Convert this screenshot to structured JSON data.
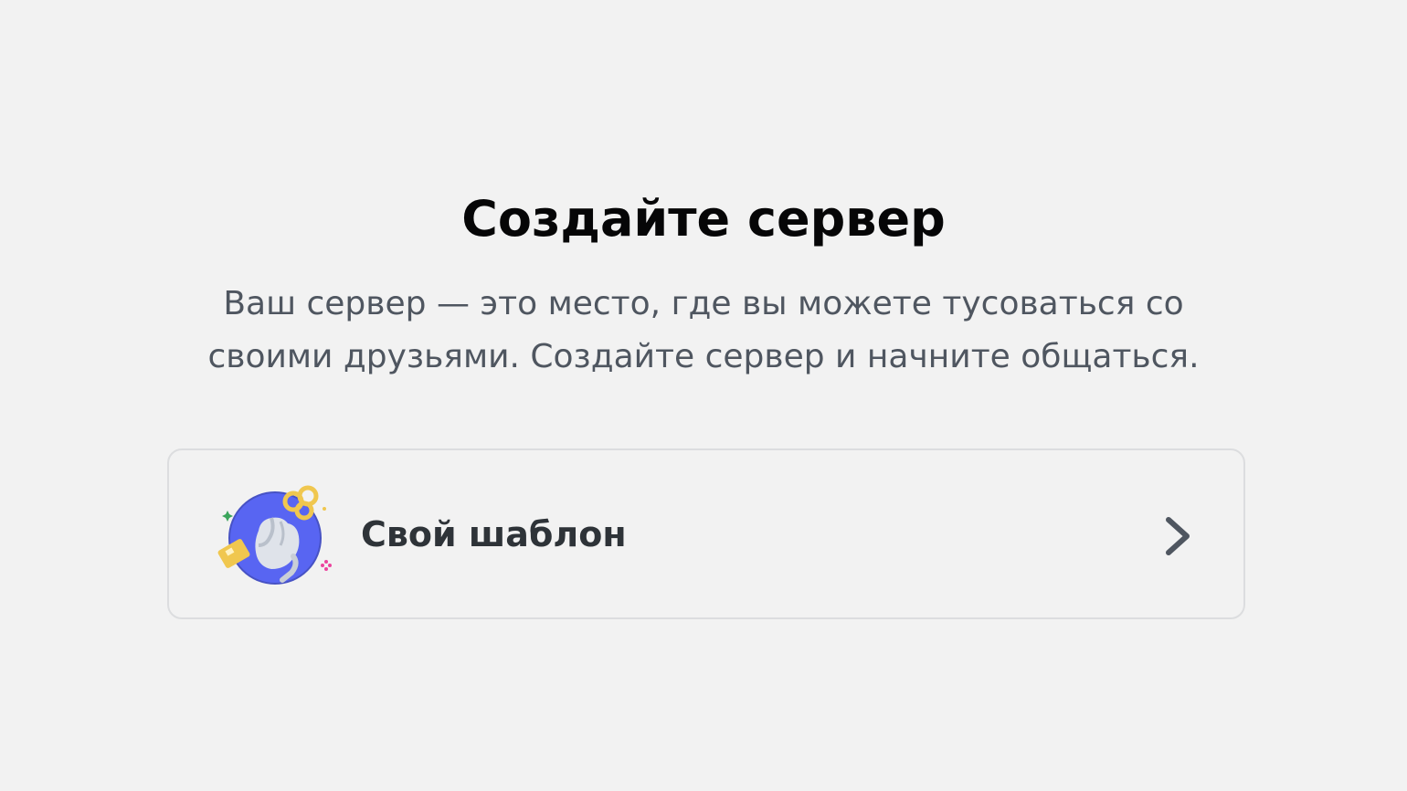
{
  "header": {
    "title": "Создайте сервер",
    "subtitle_line1": "Ваш сервер — это место, где вы можете тусоваться со",
    "subtitle_line2": "своими друзьями. Создайте сервер и начните общаться."
  },
  "options": [
    {
      "label": "Свой шаблон",
      "icon": "create-own-server-icon",
      "arrow_icon": "chevron-right-icon"
    }
  ],
  "colors": {
    "background": "#f2f2f2",
    "title": "#060607",
    "subtitle": "#4f5660",
    "card_border": "#dcdddf",
    "icon_blue": "#5865f2",
    "icon_gold": "#f0c74f"
  }
}
